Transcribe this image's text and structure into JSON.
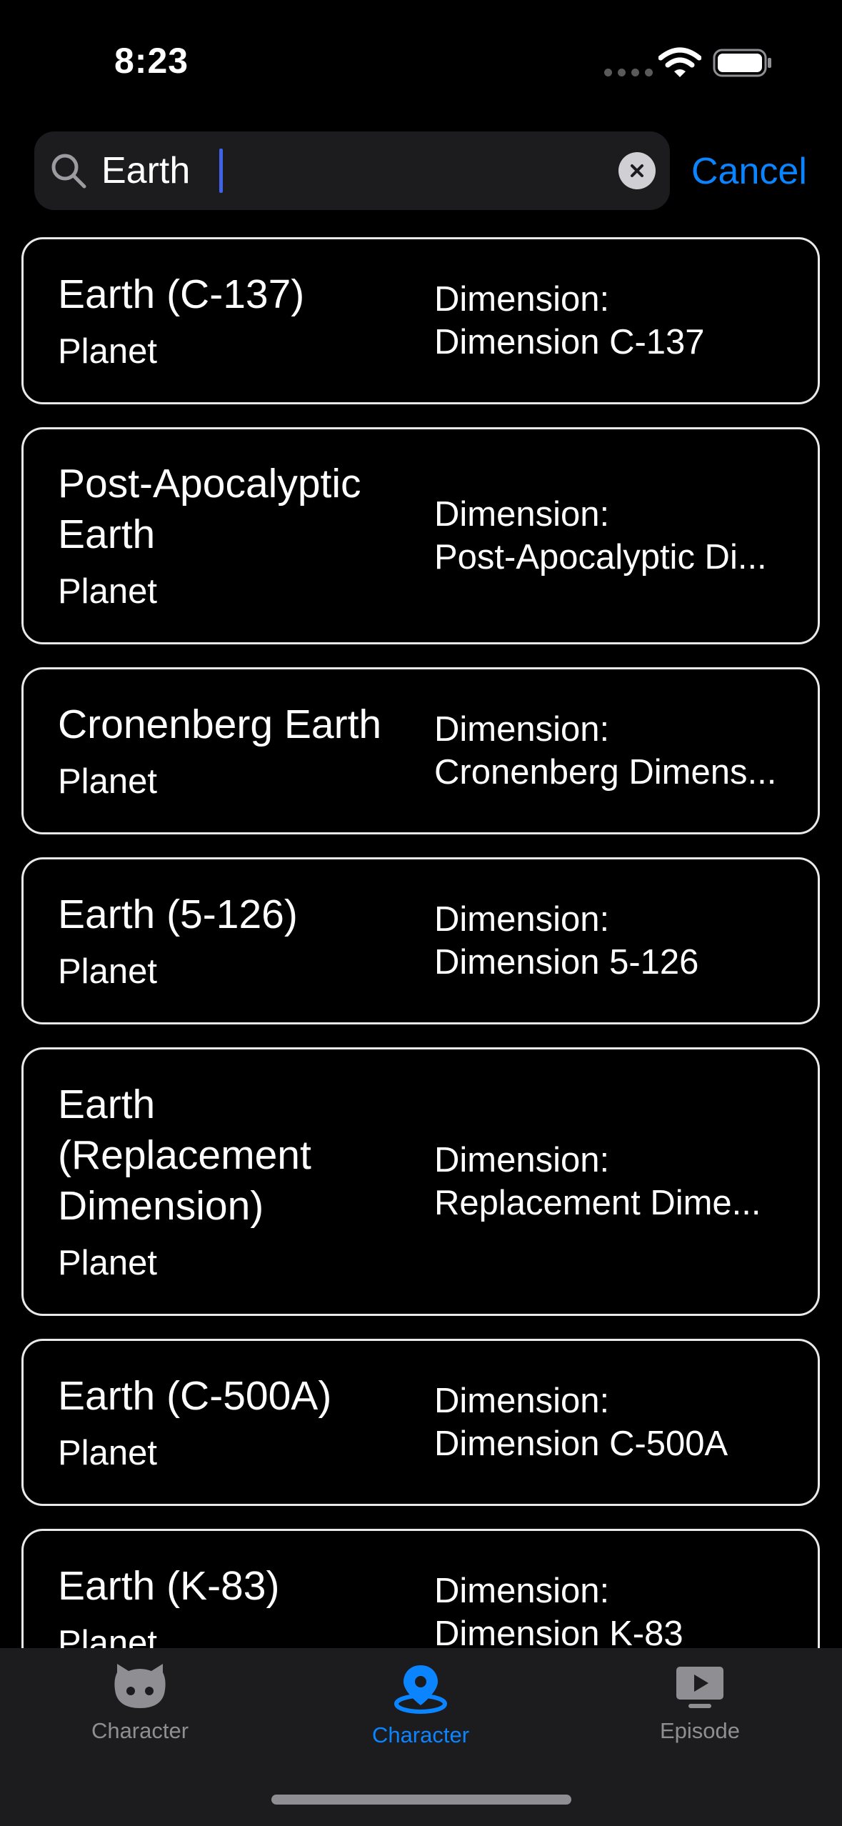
{
  "status_bar": {
    "time": "8:23"
  },
  "search": {
    "value": "Earth",
    "placeholder": "",
    "cancel_label": "Cancel"
  },
  "locations": [
    {
      "name": "Earth (C-137)",
      "type": "Planet",
      "dimension_label": "Dimension:",
      "dimension": "Dimension C-137"
    },
    {
      "name": "Post-Apocalyptic Earth",
      "type": "Planet",
      "dimension_label": "Dimension:",
      "dimension": "Post-Apocalyptic Di..."
    },
    {
      "name": "Cronenberg Earth",
      "type": "Planet",
      "dimension_label": "Dimension:",
      "dimension": "Cronenberg Dimens..."
    },
    {
      "name": "Earth (5-126)",
      "type": "Planet",
      "dimension_label": "Dimension:",
      "dimension": "Dimension 5-126"
    },
    {
      "name": "Earth (Replacement Dimension)",
      "type": "Planet",
      "dimension_label": "Dimension:",
      "dimension": "Replacement Dime..."
    },
    {
      "name": "Earth (C-500A)",
      "type": "Planet",
      "dimension_label": "Dimension:",
      "dimension": "Dimension C-500A"
    },
    {
      "name": "Earth (K-83)",
      "type": "Planet",
      "dimension_label": "Dimension:",
      "dimension": "Dimension K-83"
    }
  ],
  "tab_bar": {
    "tabs": [
      {
        "label": "Character",
        "icon": "character-face-icon",
        "active": false
      },
      {
        "label": "Character",
        "icon": "location-pin-icon",
        "active": true
      },
      {
        "label": "Episode",
        "icon": "tv-play-icon",
        "active": false
      }
    ]
  },
  "colors": {
    "accent": "#0a84ff",
    "inactive": "#8e8e93",
    "card_border": "#e9e9e9",
    "background": "#000000",
    "search_bg": "#1c1c1e"
  }
}
